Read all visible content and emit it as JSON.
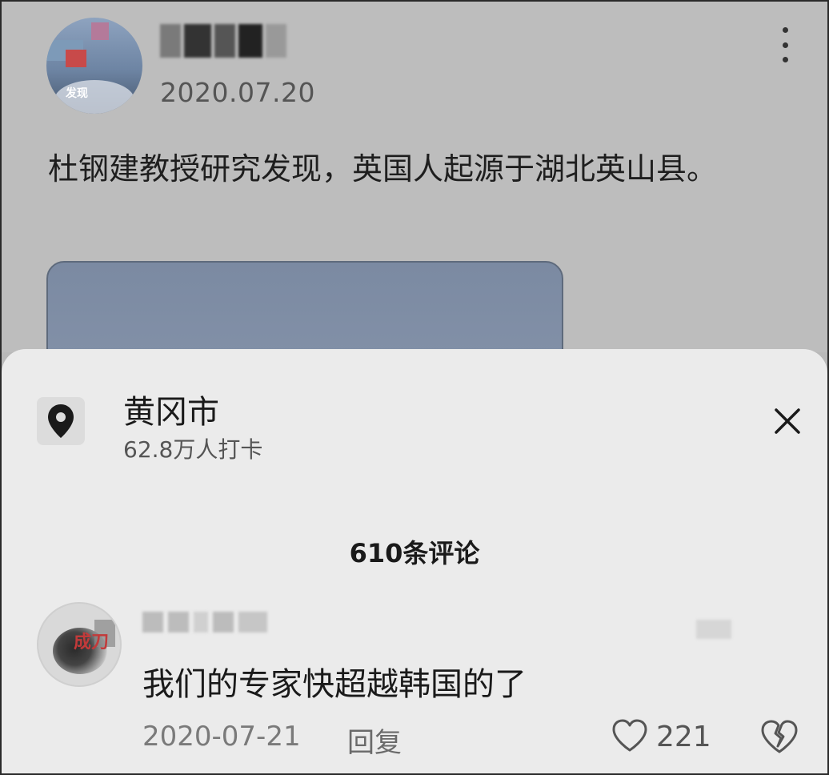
{
  "post": {
    "avatar_tag": "发现",
    "date": "2020.07.20",
    "text": "杜钢建教授研究发现，英国人起源于湖北英山县。"
  },
  "location": {
    "name": "黄冈市",
    "checkins": "62.8万人打卡"
  },
  "comments": {
    "count_label": "610条评论",
    "items": [
      {
        "avatar_seal": "成刀",
        "text": "我们的专家快超越韩国的了",
        "date": "2020-07-21",
        "reply_label": "回复",
        "likes": "221"
      }
    ]
  },
  "colors": {
    "sheet_bg": "#ebebeb",
    "dim_bg": "#bdbdbd",
    "text_primary": "#1a1a1a",
    "text_secondary": "#7a7a7a"
  },
  "icons": [
    "more-icon",
    "location-pin-icon",
    "close-icon",
    "heart-icon",
    "broken-heart-icon"
  ]
}
